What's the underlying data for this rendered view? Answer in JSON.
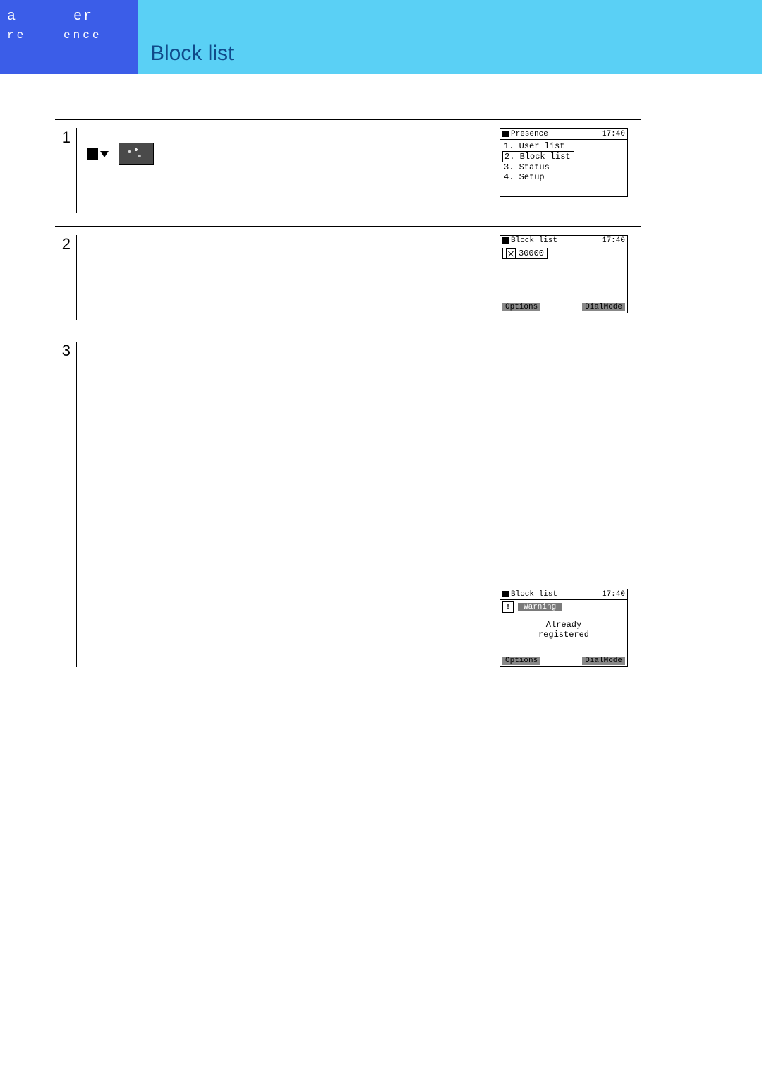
{
  "header": {
    "chapter_word1": "a",
    "chapter_word2": "er",
    "chapter_sub1": "re",
    "chapter_sub2": "ence",
    "title": "Block list"
  },
  "intro": " ",
  "steps": {
    "s1": {
      "num": "1",
      "line1": " ",
      "line2": " ",
      "line3": " "
    },
    "s2": {
      "num": "2",
      "line1": " ",
      "bul1": " ",
      "bul2": " ",
      "bul3": " ",
      "bul4": " "
    },
    "s3": {
      "num": "3",
      "line1": " ",
      "line2": " ",
      "bul1": " ",
      "bul2": " ",
      "line3": " ",
      "bul3": " ",
      "bul4": " ",
      "bul5": " ",
      "line4": " ",
      "line5": " "
    }
  },
  "lcd1": {
    "title": "Presence",
    "time": "17:40",
    "i1": "1. User list",
    "i2": "2. Block list",
    "i3": "3. Status",
    "i4": "4. Setup"
  },
  "lcd2": {
    "title": "Block list",
    "time": "17:40",
    "entry": "30000",
    "left": "Options",
    "right": "DialMode"
  },
  "lcd3": {
    "title": "Block list",
    "time": "17:40",
    "banner": "Warning",
    "msg1": "Already",
    "msg2": "registered",
    "left": "Options",
    "right": "DialMode"
  }
}
